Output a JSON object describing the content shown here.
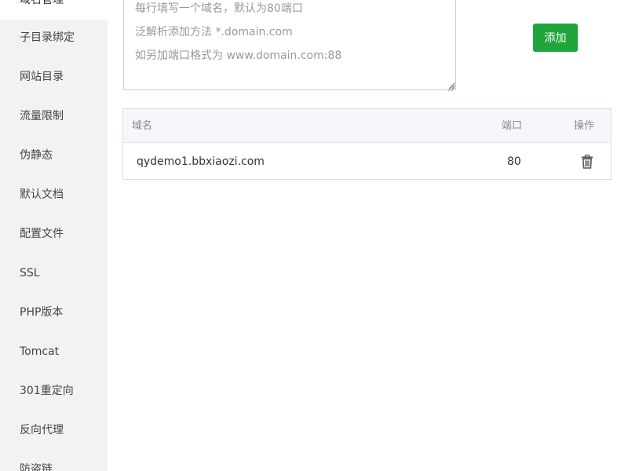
{
  "sidebar": {
    "items": [
      {
        "label": "域名管理",
        "active": true
      },
      {
        "label": "子目录绑定"
      },
      {
        "label": "网站目录"
      },
      {
        "label": "流量限制"
      },
      {
        "label": "伪静态"
      },
      {
        "label": "默认文档"
      },
      {
        "label": "配置文件"
      },
      {
        "label": "SSL"
      },
      {
        "label": "PHP版本"
      },
      {
        "label": "Tomcat"
      },
      {
        "label": "301重定向"
      },
      {
        "label": "反向代理"
      },
      {
        "label": "防盗链"
      }
    ]
  },
  "domain_input": {
    "value": "",
    "placeholder_lines": [
      "每行填写一个域名，默认为80端口",
      "泛解析添加方法 *.domain.com",
      "如另加端口格式为 www.domain.com:88"
    ]
  },
  "add_button": {
    "label": "添加"
  },
  "table": {
    "headers": {
      "domain": "域名",
      "port": "端口",
      "action": "操作"
    },
    "rows": [
      {
        "domain": "qydemo1.bbxiaozi.com",
        "port": "80"
      }
    ]
  },
  "colors": {
    "accent": "#20a53a",
    "sidebar_bg": "#f2f2f2",
    "table_header_bg": "#f5f7fa"
  },
  "icons": {
    "delete": "trash-icon",
    "resize": "resize-grip-icon"
  }
}
